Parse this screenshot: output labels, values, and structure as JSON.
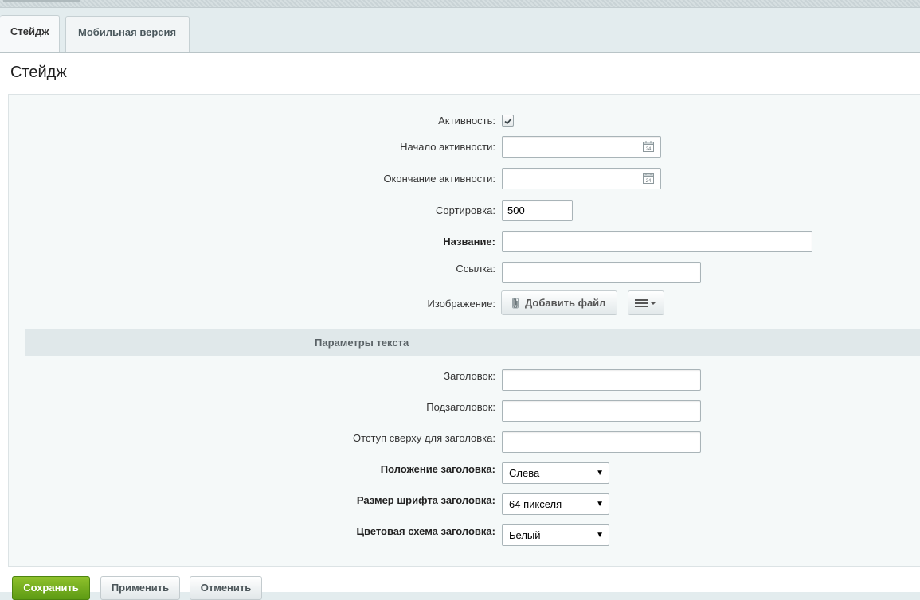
{
  "tabs": [
    {
      "label": "Стейдж",
      "active": true
    },
    {
      "label": "Мобильная версия",
      "active": false
    }
  ],
  "page_title": "Стейдж",
  "fields": {
    "activity": {
      "label": "Активность:",
      "checked": true
    },
    "active_from": {
      "label": "Начало активности:",
      "value": "",
      "icon": "calendar-icon",
      "icon_text": "24"
    },
    "active_to": {
      "label": "Окончание активности:",
      "value": "",
      "icon": "calendar-icon",
      "icon_text": "24"
    },
    "sort": {
      "label": "Сортировка:",
      "value": "500"
    },
    "name": {
      "label": "Название:",
      "value": ""
    },
    "link": {
      "label": "Ссылка:",
      "value": ""
    },
    "image": {
      "label": "Изображение:",
      "add_file_label": "Добавить файл",
      "menu_icon": "menu-icon"
    }
  },
  "text_section": {
    "heading": "Параметры текста",
    "title": {
      "label": "Заголовок:",
      "value": ""
    },
    "subtitle": {
      "label": "Подзаголовок:",
      "value": ""
    },
    "title_offset": {
      "label": "Отступ сверху для заголовка:",
      "value": ""
    },
    "title_position": {
      "label": "Положение заголовка:",
      "value": "Слева"
    },
    "title_font_size": {
      "label": "Размер шрифта заголовка:",
      "value": "64 пикселя"
    },
    "title_color_scheme": {
      "label": "Цветовая схема заголовка:",
      "value": "Белый"
    }
  },
  "buttons": {
    "save": "Сохранить",
    "apply": "Применить",
    "cancel": "Отменить"
  },
  "colors": {
    "save_button": "#6aa81c",
    "section_bg": "#e0e8ea",
    "panel_bg": "#f5f9f9"
  }
}
